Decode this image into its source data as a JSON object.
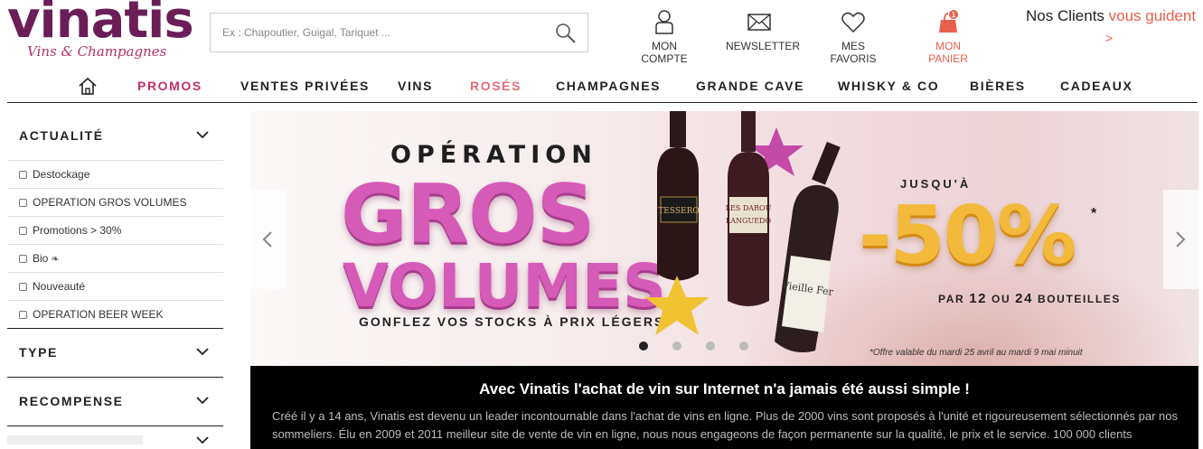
{
  "logo": {
    "word": "vinatis",
    "tagline": "Vins & Champagnes"
  },
  "search": {
    "placeholder": "Ex : Chapoutier, Guigal, Tariquet ..."
  },
  "header_links": {
    "account": "MON COMPTE",
    "newsletter": "NEWSLETTER",
    "favorites": "MES FAVORIS",
    "cart": "MON PANIER",
    "cart_count": "1"
  },
  "clients": {
    "prefix": "Nos Clients ",
    "accent": "vous guident",
    "arrow": ">"
  },
  "nav": {
    "items": [
      "PROMOS",
      "VENTES PRIVÉES",
      "VINS",
      "ROSÉS",
      "CHAMPAGNES",
      "GRANDE CAVE",
      "WHISKY & CO",
      "BIÈRES",
      "CADEAUX"
    ]
  },
  "sidebar": {
    "sections": [
      {
        "title": "ACTUALITÉ",
        "options": [
          "Destockage",
          "OPERATION GROS VOLUMES",
          "Promotions > 30%",
          "Bio",
          "Nouveauté",
          "OPERATION BEER WEEK"
        ]
      },
      {
        "title": "TYPE"
      },
      {
        "title": "RECOMPENSE"
      }
    ]
  },
  "banner": {
    "line1": "OPÉRATION",
    "line2": "GROS",
    "line3": "VOLUMES",
    "line4": "GONFLEZ VOS STOCKS À PRIX LÉGERS",
    "jusqua": "JUSQU'À",
    "discount": "-50%",
    "asterisk": "*",
    "par": "PAR",
    "qty1": "12",
    "ou": "OU",
    "qty2": "24",
    "bouteilles": "BOUTEILLES",
    "note": "*Offre valable du mardi 25 avril au mardi 9 mai minuit",
    "bottle_labels": [
      "TESSERO",
      "LES DAROU",
      "LANGUEDO",
      "Vieille Fer"
    ],
    "active_slide": 1
  },
  "promo": {
    "heading": "Avec Vinatis l'achat de vin sur Internet n'a jamais été aussi simple !",
    "paragraph": "Créé il y a 14 ans, Vinatis est devenu un leader incontournable dans l'achat de vins en ligne. Plus de 2000 vins sont proposés à l'unité et rigoureusement sélectionnés par nos sommeliers. Élu en 2009 et 2011 meilleur site de vente de vin en ligne, nous nous engageons de façon permanente sur la qualité, le prix et le service. 100 000 clients"
  },
  "colors": {
    "brand": "#6b1d57",
    "accent": "#e8604c",
    "promos": "#c2306f",
    "roses": "#e66c7b"
  }
}
